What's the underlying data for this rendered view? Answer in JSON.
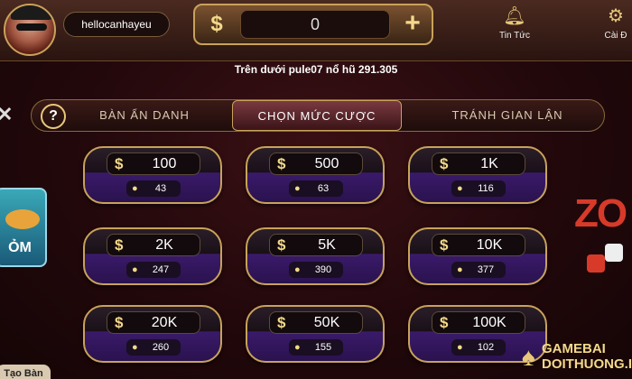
{
  "user": {
    "name": "hellocanhayeu"
  },
  "balance": {
    "symbol": "$",
    "value": "0",
    "add": "+"
  },
  "top_icons": [
    {
      "icon": "bell-icon",
      "label": "Tin Tức"
    },
    {
      "icon": "gear-icon",
      "label": "Cài Đ"
    }
  ],
  "notice": "Trên dưới pule07 nổ hũ 291.305",
  "tabs": {
    "help": "?",
    "anonymous": "BÀN ẨN DANH",
    "choose_bet": "CHỌN MỨC CƯỢC",
    "anti_cheat": "TRÁNH GIAN LẬN"
  },
  "bets": [
    {
      "amount": "100",
      "players": "43"
    },
    {
      "amount": "500",
      "players": "63"
    },
    {
      "amount": "1K",
      "players": "116"
    },
    {
      "amount": "2K",
      "players": "247"
    },
    {
      "amount": "5K",
      "players": "390"
    },
    {
      "amount": "10K",
      "players": "377"
    },
    {
      "amount": "20K",
      "players": "260"
    },
    {
      "amount": "50K",
      "players": "155"
    },
    {
      "amount": "100K",
      "players": "102"
    }
  ],
  "left_card": {
    "text": "ỎM"
  },
  "right_deco": {
    "text": "ZO"
  },
  "bottom_left": {
    "label": "Tạo Bàn"
  },
  "watermark": {
    "line1": "GAMEBAI",
    "line2": "DOITHUONG.IS"
  },
  "colors": {
    "gold": "#c9a25a",
    "accent": "#f3d98a",
    "purple": "#3a1a6a"
  }
}
